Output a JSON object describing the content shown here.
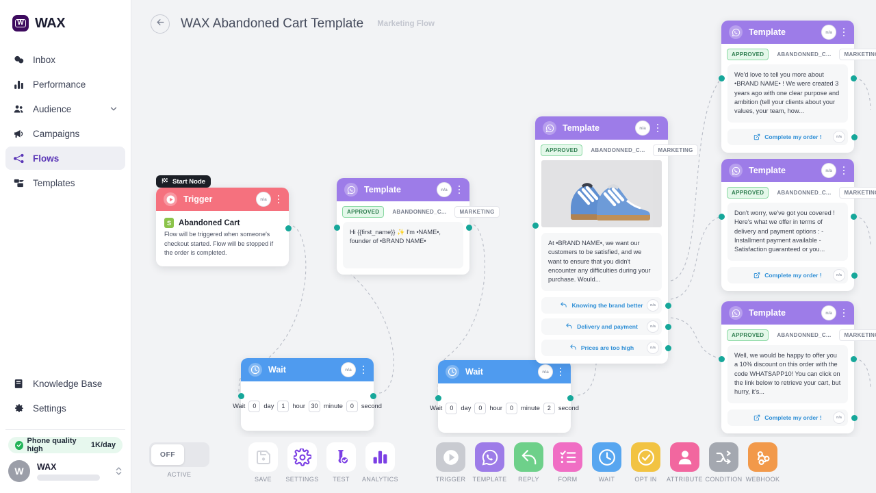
{
  "brand": {
    "mark": "W",
    "name": "WAX"
  },
  "sidebar": {
    "items": [
      {
        "label": "Inbox",
        "icon": "chat-icon",
        "active": false,
        "chevron": false
      },
      {
        "label": "Performance",
        "icon": "bar-chart-icon",
        "active": false,
        "chevron": false
      },
      {
        "label": "Audience",
        "icon": "people-icon",
        "active": false,
        "chevron": true
      },
      {
        "label": "Campaigns",
        "icon": "megaphone-icon",
        "active": false,
        "chevron": false
      },
      {
        "label": "Flows",
        "icon": "flow-icon",
        "active": true,
        "chevron": false
      },
      {
        "label": "Templates",
        "icon": "templates-icon",
        "active": false,
        "chevron": false
      }
    ],
    "bottom_items": [
      {
        "label": "Knowledge Base",
        "icon": "book-icon"
      },
      {
        "label": "Settings",
        "icon": "gear-icon"
      }
    ],
    "quality": {
      "text": "Phone quality high",
      "rate": "1K/day",
      "color": "#21b358"
    },
    "account": {
      "initial": "W",
      "name": "WAX"
    }
  },
  "header": {
    "back_icon": "arrow-left-icon",
    "title": "WAX Abandoned Cart Template",
    "subtitle": "Marketing Flow"
  },
  "canvas": {
    "start_chip": {
      "label": "Start Node",
      "icon": "flag-icon"
    },
    "na_badge": "n/a",
    "nodes": {
      "trigger": {
        "header_title": "Trigger",
        "header_color": "#f5717e",
        "header_icon": "play-circle-icon",
        "title": "Abandoned Cart",
        "source_icon": "shopify-icon",
        "description": "Flow will be triggered when someone's checkout started. Flow will be stopped if the order is completed."
      },
      "wait1": {
        "header_title": "Wait",
        "header_color": "#4f9bef",
        "header_icon": "clock-icon",
        "prefix": "Wait",
        "day": "0",
        "day_label": "day",
        "hour": "1",
        "hour_label": "hour",
        "minute": "30",
        "minute_label": "minute",
        "second": "0",
        "second_label": "second"
      },
      "wait2": {
        "header_title": "Wait",
        "header_color": "#4f9bef",
        "header_icon": "clock-icon",
        "prefix": "Wait",
        "day": "0",
        "day_label": "day",
        "hour": "0",
        "hour_label": "hour",
        "minute": "0",
        "minute_label": "minute",
        "second": "2",
        "second_label": "second"
      },
      "template1": {
        "header_title": "Template",
        "header_color": "#9d7ce8",
        "header_icon": "whatsapp-icon",
        "tags": [
          "APPROVED",
          "ABANDONNED_C...",
          "MARKETING"
        ],
        "body": "Hi {{first_name}} ✨ I'm •NAME•, founder of •BRAND NAME•"
      },
      "template2": {
        "header_title": "Template",
        "header_color": "#9d7ce8",
        "header_icon": "whatsapp-icon",
        "tags": [
          "APPROVED",
          "ABANDONNED_C...",
          "MARKETING"
        ],
        "image_alt": "blue-sneakers-image",
        "body": "At •BRAND NAME•, we want our customers to be satisfied, and we want to ensure that you didn't encounter any difficulties during your purchase. Would...",
        "buttons": [
          "Knowing the brand better",
          "Delivery and payment",
          "Prices are too high"
        ]
      },
      "template3": {
        "header_title": "Template",
        "header_color": "#9d7ce8",
        "header_icon": "whatsapp-icon",
        "tags": [
          "APPROVED",
          "ABANDONNED_C...",
          "MARKETING"
        ],
        "body": "We'd love to tell you more about •BRAND NAME• ! We were created 3 years ago with one clear purpose and ambition (tell your clients about your values, your team, how...",
        "buttons": [
          "Complete my order !"
        ]
      },
      "template4": {
        "header_title": "Template",
        "header_color": "#9d7ce8",
        "header_icon": "whatsapp-icon",
        "tags": [
          "APPROVED",
          "ABANDONNED_C...",
          "MARKETING"
        ],
        "body": "Don't worry, we've got you covered ! Here's what we offer in terms of delivery and payment options : - Installment payment available - Satisfaction guaranteed or you...",
        "buttons": [
          "Complete my order !"
        ]
      },
      "template5": {
        "header_title": "Template",
        "header_color": "#9d7ce8",
        "header_icon": "whatsapp-icon",
        "tags": [
          "APPROVED",
          "ABANDONNED_C...",
          "MARKETING"
        ],
        "body": "Well, we would be happy to offer you a 10% discount on this order with the code WHATSAPP10! You can click on the link below to retrieve your cart, but hurry, it's...",
        "buttons": [
          "Complete my order !"
        ]
      }
    }
  },
  "toolbar": {
    "toggle": {
      "state": "OFF",
      "label": "ACTIVE"
    },
    "tools": [
      {
        "label": "SAVE",
        "icon": "save-icon",
        "bg": "#ffffff",
        "fg": "#d2d4da"
      },
      {
        "label": "SETTINGS",
        "icon": "gear-icon",
        "bg": "#ffffff",
        "fg": "#7b3fe4"
      },
      {
        "label": "TEST",
        "icon": "test-tube-icon",
        "bg": "#ffffff",
        "fg": "#7b3fe4"
      },
      {
        "label": "ANALYTICS",
        "icon": "bar-chart-icon",
        "bg": "#ffffff",
        "fg": "#7b3fe4"
      },
      {
        "label": "TRIGGER",
        "icon": "play-icon",
        "bg": "#c9cbd1",
        "fg": "#ffffff"
      },
      {
        "label": "TEMPLATE",
        "icon": "whatsapp-icon",
        "bg": "#9d7ce8",
        "fg": "#ffffff"
      },
      {
        "label": "REPLY",
        "icon": "reply-icon",
        "bg": "#6ed08a",
        "fg": "#ffffff"
      },
      {
        "label": "FORM",
        "icon": "checklist-icon",
        "bg": "#f06ec4",
        "fg": "#ffffff"
      },
      {
        "label": "WAIT",
        "icon": "clock-icon",
        "bg": "#57a6f0",
        "fg": "#ffffff"
      },
      {
        "label": "OPT IN",
        "icon": "check-circle-icon",
        "bg": "#f2c342",
        "fg": "#ffffff"
      },
      {
        "label": "ATTRIBUTE",
        "icon": "person-icon",
        "bg": "#f2679f",
        "fg": "#ffffff"
      },
      {
        "label": "CONDITION",
        "icon": "branch-icon",
        "bg": "#a4a8b0",
        "fg": "#ffffff"
      },
      {
        "label": "WEBHOOK",
        "icon": "webhook-icon",
        "bg": "#f2994a",
        "fg": "#ffffff"
      }
    ]
  }
}
